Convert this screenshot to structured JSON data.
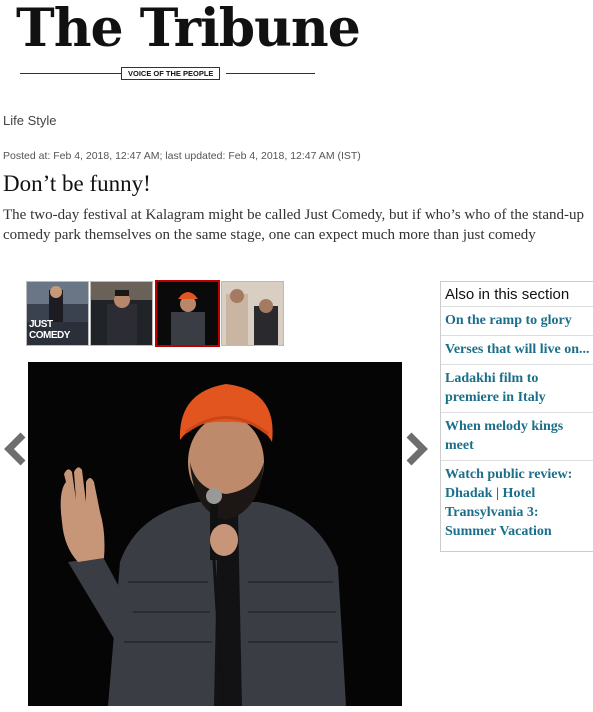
{
  "masthead": {
    "title": "The Tribune",
    "tagline": "VOICE OF THE PEOPLE"
  },
  "article": {
    "category": "Life Style",
    "posted": "Posted at: Feb 4, 2018, 12:47 AM; last updated: Feb 4, 2018, 12:47 AM (IST)",
    "headline": "Don’t be funny!",
    "summary": "The two-day festival at Kalagram might be called Just Comedy, but if who’s who of the stand-up comedy park themselves on the same stage, one can expect much more than just comedy"
  },
  "gallery": {
    "thumb1_caption": "JUST COMEDY",
    "active_index": 3,
    "prev_icon": "chevron-left-icon",
    "next_icon": "chevron-right-icon"
  },
  "sidebar": {
    "heading": "Also in this section",
    "items": [
      "On the ramp to glory",
      "Verses that will live on...",
      "Ladakhi film to premiere in Italy",
      "When melody kings meet",
      "Watch public review: Dhadak | Hotel Transylvania 3: Summer Vacation"
    ]
  },
  "colors": {
    "link": "#1a6f8a",
    "active_thumb_border": "#bb0000",
    "turban": "#e2551f"
  }
}
